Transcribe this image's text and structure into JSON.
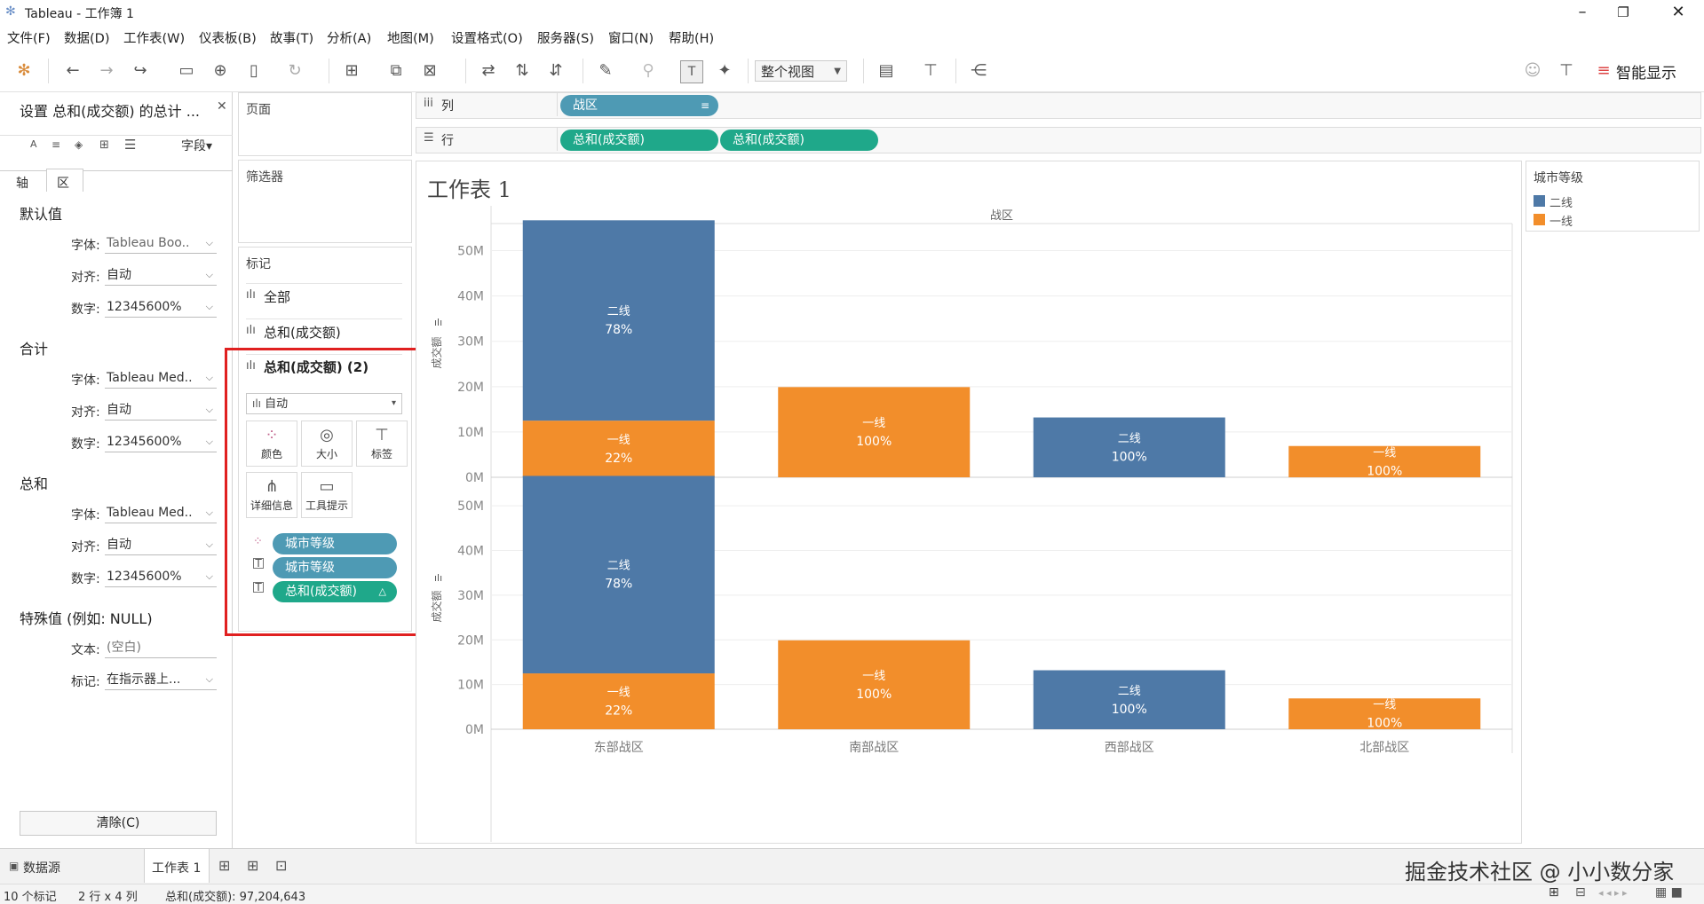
{
  "window": {
    "title": "Tableau - 工作簿 1"
  },
  "menu": [
    "文件(F)",
    "数据(D)",
    "工作表(W)",
    "仪表板(B)",
    "故事(T)",
    "分析(A)",
    "地图(M)",
    "设置格式(O)",
    "服务器(S)",
    "窗口(N)",
    "帮助(H)"
  ],
  "toolbar": {
    "view_select": "整个视图",
    "show_me": "智能显示"
  },
  "format_panel": {
    "title": "设置 总和(成交额) 的总计 ...",
    "fields_label": "字段",
    "tabs": [
      "轴",
      "区"
    ],
    "sections": [
      {
        "heading": "默认值",
        "rows": [
          {
            "label": "字体:",
            "value": "Tableau Boo.."
          },
          {
            "label": "对齐:",
            "value": "自动"
          },
          {
            "label": "数字:",
            "value": "12345600%"
          }
        ]
      },
      {
        "heading": "合计",
        "rows": [
          {
            "label": "字体:",
            "value": "Tableau Med.."
          },
          {
            "label": "对齐:",
            "value": "自动"
          },
          {
            "label": "数字:",
            "value": "12345600%"
          }
        ]
      },
      {
        "heading": "总和",
        "rows": [
          {
            "label": "字体:",
            "value": "Tableau Med.."
          },
          {
            "label": "对齐:",
            "value": "自动"
          },
          {
            "label": "数字:",
            "value": "12345600%"
          }
        ]
      }
    ],
    "special": {
      "heading": "特殊值 (例如: NULL)",
      "text_label": "文本:",
      "text_placeholder": "(空白)",
      "mark_label": "标记:",
      "mark_value": "在指示器上..."
    },
    "clear_button": "清除(C)"
  },
  "pages_label": "页面",
  "filters_label": "筛选器",
  "marks": {
    "title": "标记",
    "cards": [
      "全部",
      "总和(成交额)",
      "总和(成交额) (2)"
    ],
    "mark_type": "自动",
    "buttons": [
      "颜色",
      "大小",
      "标签",
      "详细信息",
      "工具提示"
    ],
    "fields": [
      "城市等级",
      "城市等级",
      "总和(成交额)"
    ]
  },
  "shelves": {
    "columns_label": "列",
    "rows_label": "行",
    "columns": [
      "战区"
    ],
    "rows": [
      "总和(成交额)",
      "总和(成交额)"
    ]
  },
  "legend": {
    "title": "城市等级",
    "items": [
      {
        "label": "二线",
        "color": "#4e79a7"
      },
      {
        "label": "一线",
        "color": "#f28e2b"
      }
    ]
  },
  "chart_data": {
    "type": "bar",
    "title": "工作表 1",
    "header": "战区",
    "categories": [
      "东部战区",
      "南部战区",
      "西部战区",
      "北部战区"
    ],
    "ylabel": "成交额",
    "yticks": [
      "0M",
      "10M",
      "20M",
      "30M",
      "40M",
      "50M"
    ],
    "ylim": [
      0,
      55
    ],
    "stacked": true,
    "panes": 2,
    "series": [
      {
        "name": "一线",
        "color": "#f28e2b",
        "values": [
          12.5,
          19.9,
          0,
          6.9
        ],
        "labels": [
          "22%",
          "100%",
          "",
          "100%"
        ]
      },
      {
        "name": "二线",
        "color": "#4e79a7",
        "values": [
          44.2,
          0,
          13.2,
          0
        ],
        "labels": [
          "78%",
          "",
          "100%",
          ""
        ]
      }
    ]
  },
  "bottom_tabs": {
    "datasource": "数据源",
    "sheet": "工作表 1"
  },
  "status": {
    "marks": "10 个标记",
    "dims": "2 行 x 4 列",
    "sum": "总和(成交额): 97,204,643"
  },
  "watermark": "掘金技术社区 @ 小小数分家"
}
